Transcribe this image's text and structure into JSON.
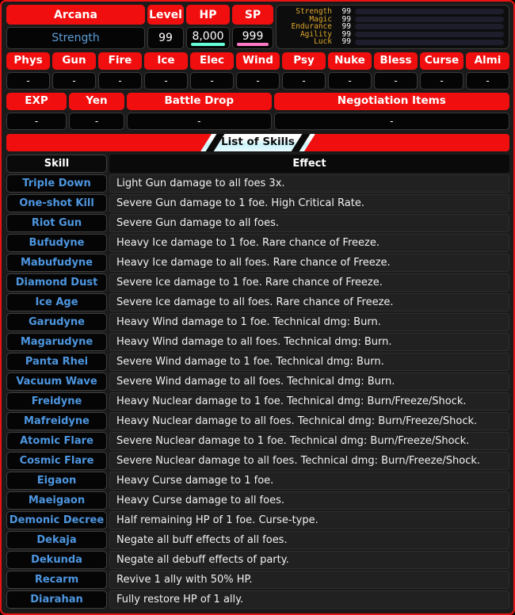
{
  "colors": {
    "accent_red": "#f10e0e",
    "skill_blue": "#4d96e0",
    "stat_gold": "#e0a92b",
    "hp_bar": "#64ffda",
    "sp_bar": "#ff79c6"
  },
  "summary": {
    "arcana_label": "Arcana",
    "arcana_value": "Strength",
    "level_label": "Level",
    "level_value": "99",
    "hp_label": "HP",
    "hp_value": "8,000",
    "sp_label": "SP",
    "sp_value": "999"
  },
  "stats": [
    {
      "name": "Strength",
      "value": "99",
      "percent": 100
    },
    {
      "name": "Magic",
      "value": "99",
      "percent": 100
    },
    {
      "name": "Endurance",
      "value": "99",
      "percent": 100
    },
    {
      "name": "Agility",
      "value": "99",
      "percent": 100
    },
    {
      "name": "Luck",
      "value": "99",
      "percent": 100
    }
  ],
  "affinities": [
    {
      "label": "Phys",
      "value": "-"
    },
    {
      "label": "Gun",
      "value": "-"
    },
    {
      "label": "Fire",
      "value": "-"
    },
    {
      "label": "Ice",
      "value": "-"
    },
    {
      "label": "Elec",
      "value": "-"
    },
    {
      "label": "Wind",
      "value": "-"
    },
    {
      "label": "Psy",
      "value": "-"
    },
    {
      "label": "Nuke",
      "value": "-"
    },
    {
      "label": "Bless",
      "value": "-"
    },
    {
      "label": "Curse",
      "value": "-"
    },
    {
      "label": "Almi",
      "value": "-"
    }
  ],
  "rewards": [
    {
      "label": "EXP",
      "value": "-"
    },
    {
      "label": "Yen",
      "value": "-"
    },
    {
      "label": "Battle Drop",
      "value": "-"
    },
    {
      "label": "Negotiation Items",
      "value": "-"
    }
  ],
  "banner": {
    "title": "List of Skills"
  },
  "skills_table": {
    "headers": {
      "skill": "Skill",
      "effect": "Effect"
    },
    "rows": [
      {
        "skill": "Triple Down",
        "effect": "Light Gun damage to all foes 3x."
      },
      {
        "skill": "One-shot Kill",
        "effect": "Severe Gun damage to 1 foe. High Critical Rate."
      },
      {
        "skill": "Riot Gun",
        "effect": "Severe Gun damage to all foes."
      },
      {
        "skill": "Bufudyne",
        "effect": "Heavy Ice damage to 1 foe. Rare chance of Freeze."
      },
      {
        "skill": "Mabufudyne",
        "effect": "Heavy Ice damage to all foes. Rare chance of Freeze."
      },
      {
        "skill": "Diamond Dust",
        "effect": "Severe Ice damage to 1 foe. Rare chance of Freeze."
      },
      {
        "skill": "Ice Age",
        "effect": "Severe Ice damage to all foes. Rare chance of Freeze."
      },
      {
        "skill": "Garudyne",
        "effect": "Heavy Wind damage to 1 foe. Technical dmg: Burn."
      },
      {
        "skill": "Magarudyne",
        "effect": "Heavy Wind damage to all foes. Technical dmg: Burn."
      },
      {
        "skill": "Panta Rhei",
        "effect": "Severe Wind damage to 1 foe. Technical dmg: Burn."
      },
      {
        "skill": "Vacuum Wave",
        "effect": "Severe Wind damage to all foes. Technical dmg: Burn."
      },
      {
        "skill": "Freidyne",
        "effect": "Heavy Nuclear damage to 1 foe. Technical dmg: Burn/Freeze/Shock."
      },
      {
        "skill": "Mafreidyne",
        "effect": "Heavy Nuclear damage to all foes. Technical dmg: Burn/Freeze/Shock."
      },
      {
        "skill": "Atomic Flare",
        "effect": "Severe Nuclear damage to 1 foe. Technical dmg: Burn/Freeze/Shock."
      },
      {
        "skill": "Cosmic Flare",
        "effect": "Severe Nuclear damage to all foes. Technical dmg: Burn/Freeze/Shock."
      },
      {
        "skill": "Eigaon",
        "effect": "Heavy Curse damage to 1 foe."
      },
      {
        "skill": "Maeigaon",
        "effect": "Heavy Curse damage to all foes."
      },
      {
        "skill": "Demonic Decree",
        "effect": "Half remaining HP of 1 foe. Curse-type."
      },
      {
        "skill": "Dekaja",
        "effect": "Negate all buff effects of all foes."
      },
      {
        "skill": "Dekunda",
        "effect": "Negate all debuff effects of party."
      },
      {
        "skill": "Recarm",
        "effect": "Revive 1 ally with 50% HP."
      },
      {
        "skill": "Diarahan",
        "effect": "Fully restore HP of 1 ally."
      }
    ]
  }
}
